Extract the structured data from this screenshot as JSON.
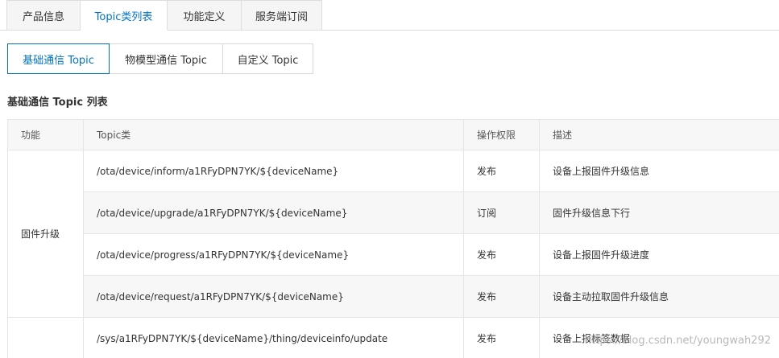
{
  "top_tabs": [
    {
      "label": "产品信息",
      "active": false
    },
    {
      "label": "Topic类列表",
      "active": true
    },
    {
      "label": "功能定义",
      "active": false
    },
    {
      "label": "服务端订阅",
      "active": false
    }
  ],
  "sub_tabs": [
    {
      "label": "基础通信 Topic",
      "active": true
    },
    {
      "label": "物模型通信 Topic",
      "active": false
    },
    {
      "label": "自定义 Topic",
      "active": false
    }
  ],
  "section_title": "基础通信 Topic 列表",
  "table": {
    "headers": [
      "功能",
      "Topic类",
      "操作权限",
      "描述"
    ],
    "groups": [
      {
        "feature": "固件升级",
        "rows": [
          {
            "topic": "/ota/device/inform/a1RFyDPN7YK/${deviceName}",
            "permission": "发布",
            "description": "设备上报固件升级信息"
          },
          {
            "topic": "/ota/device/upgrade/a1RFyDPN7YK/${deviceName}",
            "permission": "订阅",
            "description": "固件升级信息下行"
          },
          {
            "topic": "/ota/device/progress/a1RFyDPN7YK/${deviceName}",
            "permission": "发布",
            "description": "设备上报固件升级进度"
          },
          {
            "topic": "/ota/device/request/a1RFyDPN7YK/${deviceName}",
            "permission": "发布",
            "description": "设备主动拉取固件升级信息"
          }
        ]
      },
      {
        "feature": "",
        "rows": [
          {
            "topic": "/sys/a1RFyDPN7YK/${deviceName}/thing/deviceinfo/update",
            "permission": "发布",
            "description": "设备上报标签数据"
          }
        ]
      }
    ]
  },
  "watermark": "https://blog.csdn.net/youngwah292",
  "colors": {
    "accent": "#0073c8",
    "border": "#e6e6e6",
    "header_bg": "#f7f7f7"
  }
}
